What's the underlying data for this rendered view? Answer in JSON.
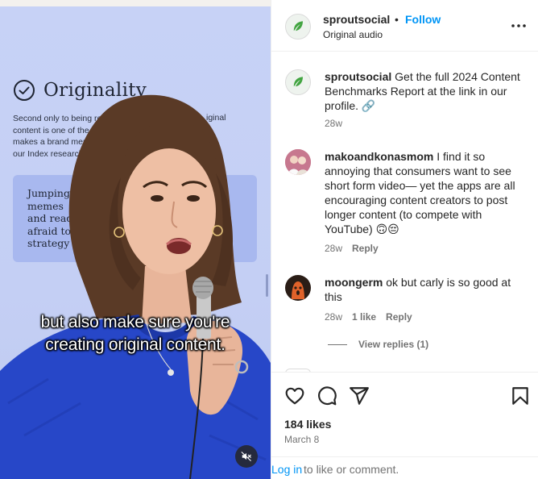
{
  "media": {
    "slide_title": "Originality",
    "slide_body_lines": [
      "Second only to being resp",
      "content is one of the top",
      "makes a brand memora",
      "our Index research."
    ],
    "slide_body_right": [
      "iginal"
    ],
    "slide_card_lines": [
      "Jumping",
      "memes",
      "and read",
      "afraid to",
      "strategy"
    ],
    "caption_line1": "but also make sure you're",
    "caption_line2": "creating original content."
  },
  "header": {
    "username": "sproutsocial",
    "separator": "•",
    "follow_label": "Follow",
    "audio_label": "Original audio",
    "more_icon": "more-horizontal-icon"
  },
  "comments": [
    {
      "username": "sproutsocial",
      "text": "Get the full 2024 Content Benchmarks Report at the link in our profile. 🔗",
      "time": "28w"
    },
    {
      "username": "makoandkonasmom",
      "text": "I find it so annoying that consumers want to see short form video— yet the apps are all encouraging content creators to post longer content (to compete with YouTube) 🙃😔",
      "time": "28w",
      "reply_label": "Reply"
    },
    {
      "username": "moongerm",
      "text": "ok but carly is so good at this",
      "time": "28w",
      "likes_label": "1 like",
      "reply_label": "Reply"
    }
  ],
  "view_replies_label": "View replies (1)",
  "footer": {
    "likes": "184 likes",
    "date": "March 8",
    "login_link": "Log in",
    "login_rest": "to like or comment."
  },
  "colors": {
    "accent": "#0095f6",
    "text": "#262626",
    "muted": "#737373",
    "slide_bg": "#c7d2f6",
    "sweater": "#2747c8"
  }
}
